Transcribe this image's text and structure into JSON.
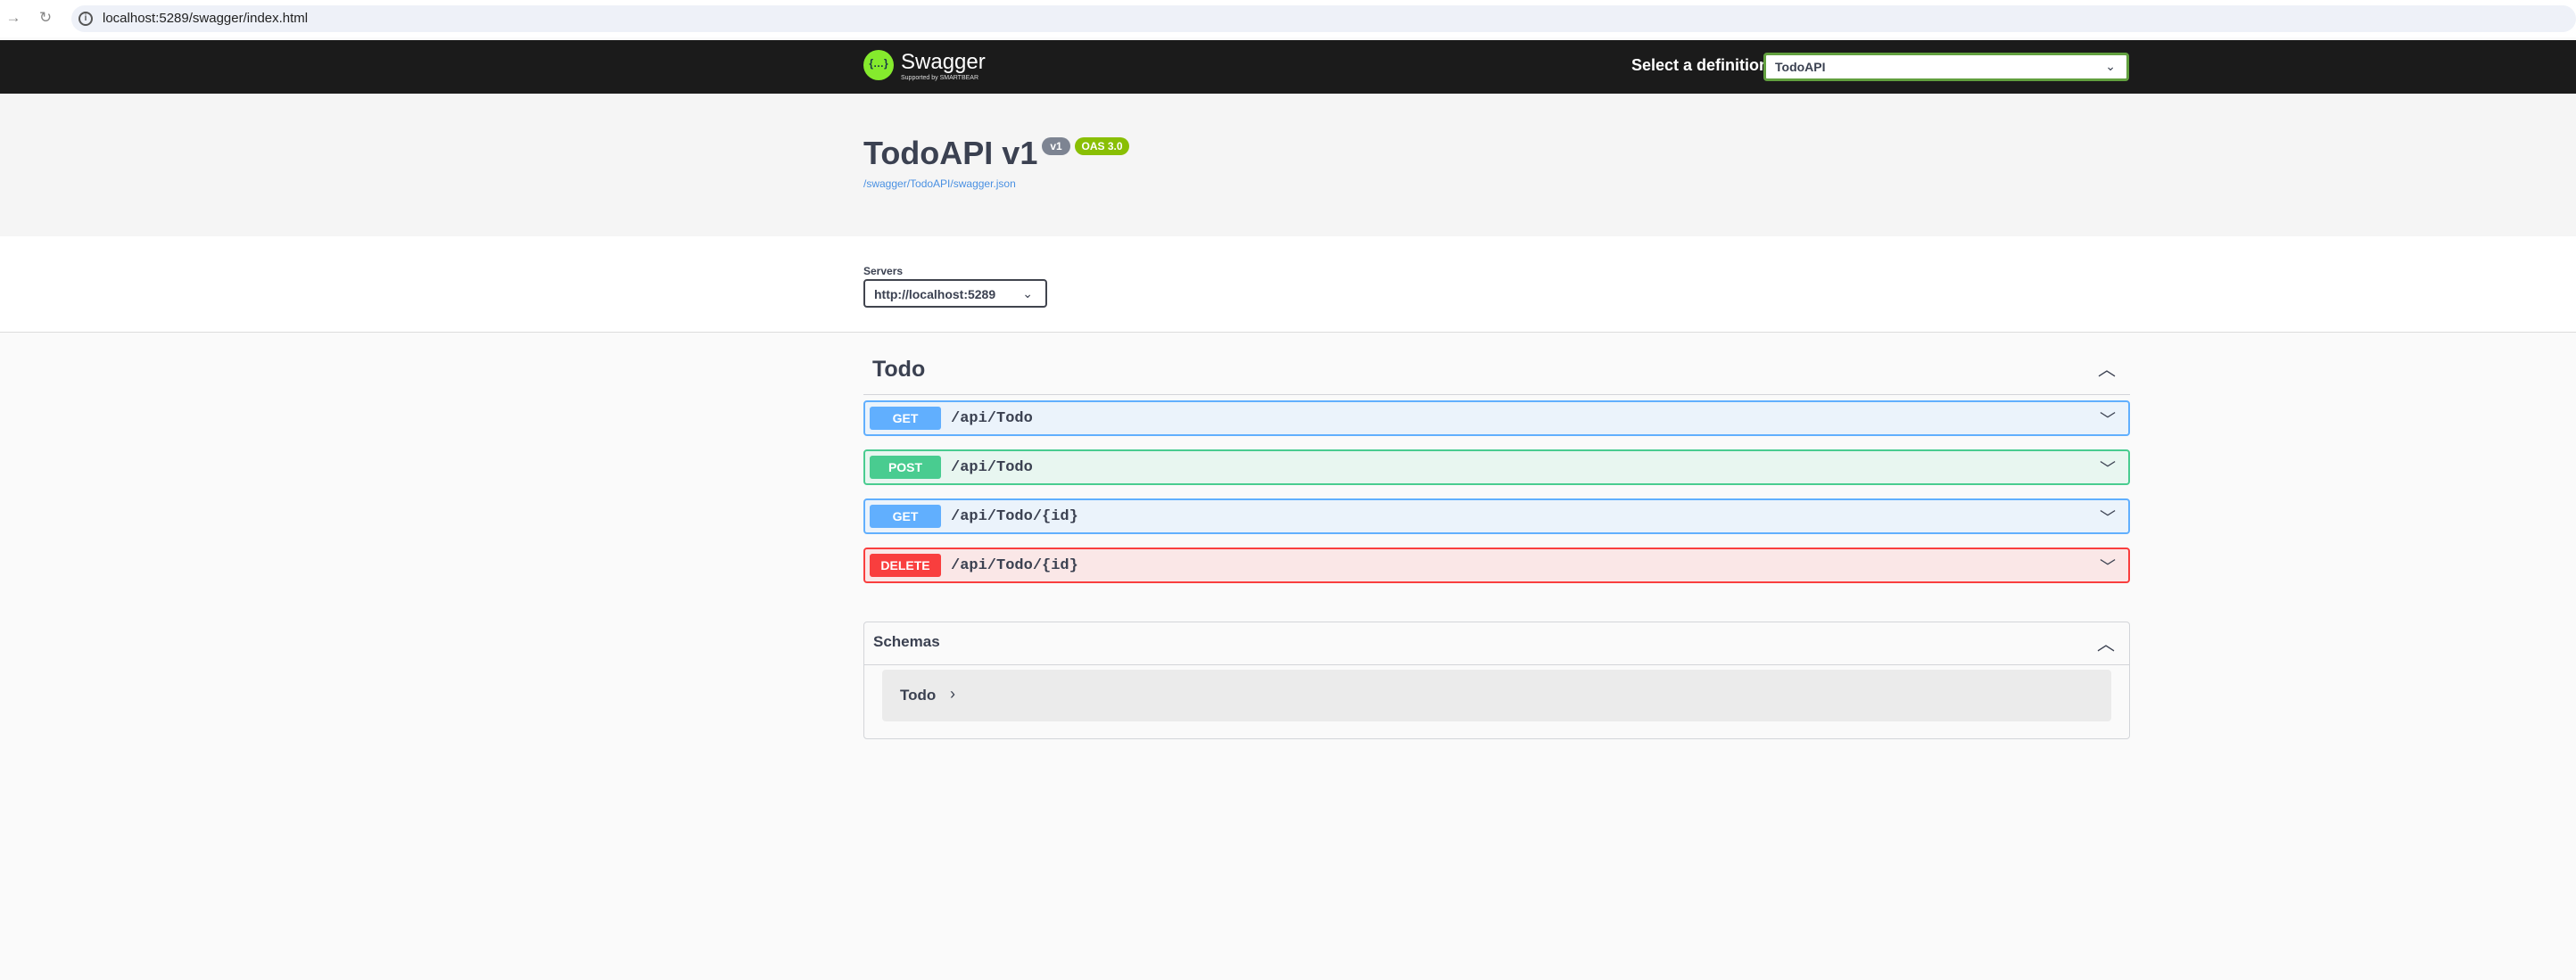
{
  "browser": {
    "url": "localhost:5289/swagger/index.html"
  },
  "topbar": {
    "logo_name": "Swagger",
    "logo_sub": "Supported by SMARTBEAR",
    "select_label": "Select a definition",
    "selected_definition": "TodoAPI"
  },
  "info": {
    "title": "TodoAPI v1",
    "version_badge": "v1",
    "oas_badge": "OAS 3.0",
    "spec_link": "/swagger/TodoAPI/swagger.json"
  },
  "servers": {
    "label": "Servers",
    "selected": "http://localhost:5289"
  },
  "tag": {
    "name": "Todo"
  },
  "operations": [
    {
      "method": "GET",
      "path": "/api/Todo"
    },
    {
      "method": "POST",
      "path": "/api/Todo"
    },
    {
      "method": "GET",
      "path": "/api/Todo/{id}"
    },
    {
      "method": "DELETE",
      "path": "/api/Todo/{id}"
    }
  ],
  "schemas": {
    "title": "Schemas",
    "models": [
      {
        "name": "Todo"
      }
    ]
  },
  "colors": {
    "get": "#61affe",
    "post": "#49cc90",
    "delete": "#f93e3e",
    "topbar": "#1b1b1b",
    "brand": "#85ea2d"
  }
}
